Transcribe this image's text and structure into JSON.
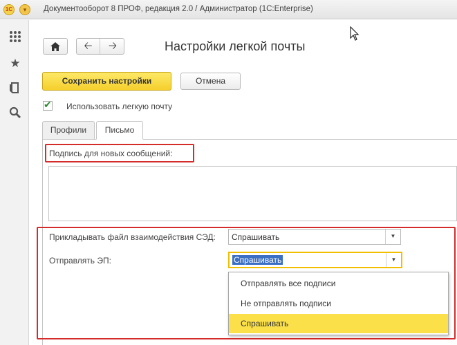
{
  "window": {
    "title": "Документооборот 8 ПРОФ, редакция 2.0 / Администратор  (1С:Enterprise)",
    "logo_text": "1С"
  },
  "left_panel": {
    "icons": [
      "apps-grid-icon",
      "star-icon",
      "history-icon",
      "search-icon"
    ]
  },
  "header": {
    "title": "Настройки легкой почты"
  },
  "toolbar": {
    "save_label": "Сохранить настройки",
    "cancel_label": "Отмена"
  },
  "use_easy_mail": {
    "label": "Использовать легкую почту",
    "checked": true
  },
  "tabs": [
    {
      "label": "Профили",
      "active": false
    },
    {
      "label": "Письмо",
      "active": true
    }
  ],
  "letter_tab": {
    "signature_label": "Подпись для новых сообщений:",
    "signature_value": "",
    "attach_file_label": "Прикладывать файл взаимодействия СЭД:",
    "attach_file_value": "Спрашивать",
    "send_ep_label": "Отправлять ЭП:",
    "send_ep_value": "Спрашивать"
  },
  "send_ep_dropdown": {
    "options": [
      "Отправлять все подписи",
      "Не отправлять подписи",
      "Спрашивать"
    ],
    "selected": "Спрашивать"
  },
  "colors": {
    "accent_yellow": "#f5cf2c",
    "highlight_red": "#d42b2b",
    "selection_blue": "#3b6fc4"
  }
}
